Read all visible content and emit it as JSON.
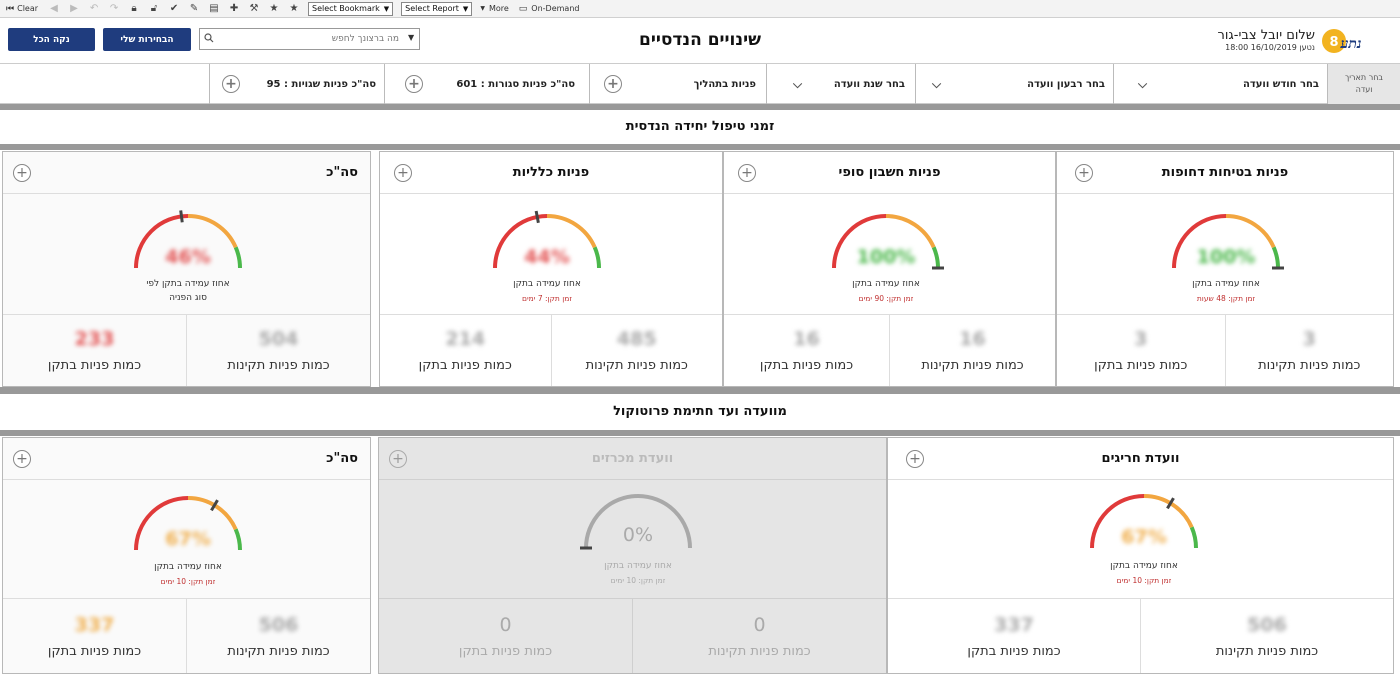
{
  "toolbar": {
    "clear": "Clear",
    "bookmark": "Select Bookmark",
    "report": "Select Report",
    "more": "More",
    "ondemand": "On-Demand"
  },
  "header": {
    "clear_all": "נקה הכל",
    "my_selections": "הבחירות שלי",
    "search_placeholder": "מה ברצונך לחפש",
    "title": "שינויים הנדסיים",
    "user_name": "שלום יובל צבי-גור",
    "load_time": "נטען 16/10/2019 18:00"
  },
  "filters": {
    "date_committee": "בחר תאריך ועדה",
    "month_committee": "בחר חודש וועדה",
    "quarter_committee": "בחר רבעון וועדה",
    "year_committee": "בחר שנת וועדה",
    "in_process": "פניות בתהליך",
    "closed": "סה\"כ פניות סגורות : 601",
    "errors": "סה\"כ פניות שגויות : 95"
  },
  "sections": {
    "s1": "זמני טיפול יחידה הנדסית",
    "s2": "מוועדה ועד חתימת פרוטוקול"
  },
  "cards": {
    "safety": {
      "title": "פניות בטיחות דחופות",
      "pct": "100%",
      "label": "אחוז עמידה בתקן",
      "sub": "זמן תקן: 48 שעות",
      "valid": "3",
      "within": "3",
      "valid_lbl": "כמות פניות תקינות",
      "within_lbl": "כמות פניות בתקן"
    },
    "final": {
      "title": "פניות חשבון סופי",
      "pct": "100%",
      "label": "אחוז עמידה בתקן",
      "sub": "זמן תקן: 90 ימים",
      "valid": "16",
      "within": "16",
      "valid_lbl": "כמות פניות תקינות",
      "within_lbl": "כמות פניות בתקן"
    },
    "general": {
      "title": "פניות כלליות",
      "pct": "44%",
      "label": "אחוז עמידה בתקן",
      "sub": "זמן תקן: 7 ימים",
      "valid": "485",
      "within": "214",
      "valid_lbl": "כמות פניות תקינות",
      "within_lbl": "כמות פניות בתקן"
    },
    "total1": {
      "title": "סה\"כ",
      "pct": "46%",
      "label": "אחוז עמידה בתקן לפי",
      "label2": "סוג הפניה",
      "valid": "504",
      "within": "233",
      "valid_lbl": "כמות פניות תקינות",
      "within_lbl": "כמות פניות בתקן"
    },
    "exceptional": {
      "title": "וועדת חריגים",
      "pct": "67%",
      "label": "אחוז עמידה בתקן",
      "sub": "זמן תקן: 10 ימים",
      "valid": "506",
      "within": "337",
      "valid_lbl": "כמות פניות תקינות",
      "within_lbl": "כמות פניות בתקן"
    },
    "tenders": {
      "title": "וועדת מכרזים",
      "pct": "0%",
      "label": "אחוז עמידה בתקן",
      "sub": "זמן תקן: 10 ימים",
      "valid": "0",
      "within": "0",
      "valid_lbl": "כמות פניות תקינות",
      "within_lbl": "כמות פניות בתקן"
    },
    "total2": {
      "title": "סה\"כ",
      "pct": "67%",
      "label": "אחוז עמידה בתקן",
      "sub": "זמן תקן: 10 ימים",
      "valid": "506",
      "within": "337",
      "valid_lbl": "כמות פניות תקינות",
      "within_lbl": "כמות פניות בתקן"
    }
  },
  "gauge_values": {
    "safety": 1.0,
    "final": 1.0,
    "general": 0.44,
    "total1": 0.46,
    "exceptional": 0.67,
    "tenders": 0.0,
    "total2": 0.67
  },
  "colors": {
    "red": "#e03a3a",
    "orange": "#f2a640",
    "green": "#4bb84b",
    "navy": "#1f3c7e",
    "gray_arc": "#a9a9a9"
  }
}
